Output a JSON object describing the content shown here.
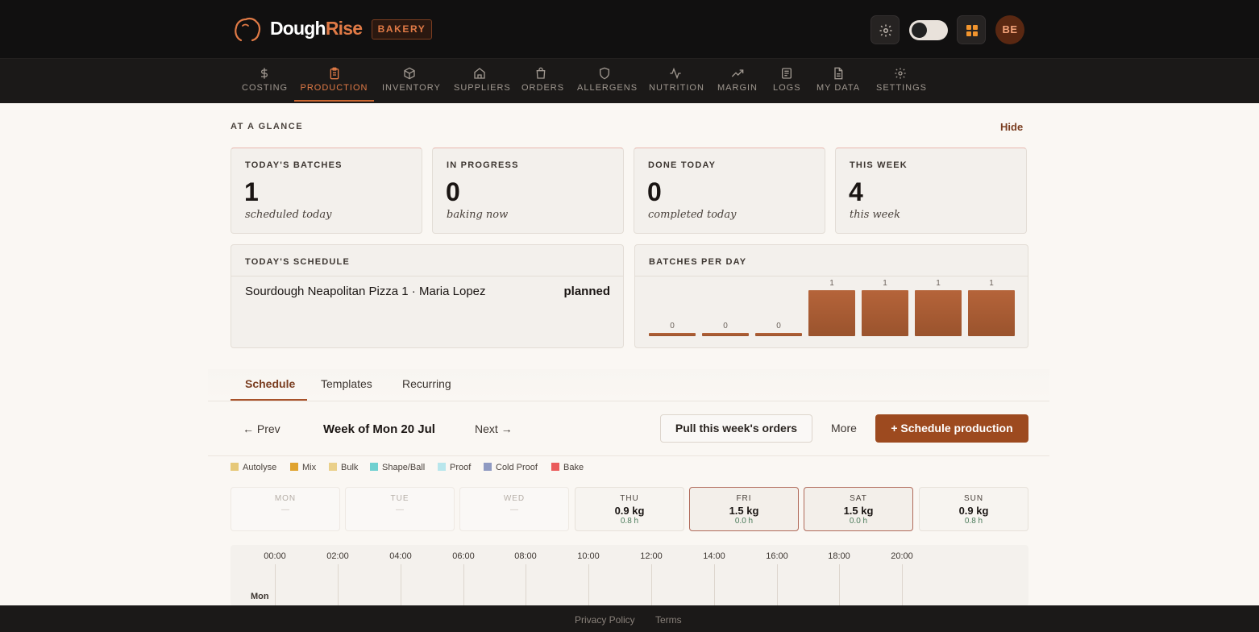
{
  "header": {
    "brand_main": "Dough",
    "brand_accent": "Rise",
    "badge": "BAKERY",
    "avatar_initials": "BE"
  },
  "nav": [
    {
      "label": "COSTING",
      "icon": "dollar-icon"
    },
    {
      "label": "PRODUCTION",
      "icon": "clipboard-icon",
      "active": true
    },
    {
      "label": "INVENTORY",
      "icon": "box-icon"
    },
    {
      "label": "SUPPLIERS",
      "icon": "home-icon"
    },
    {
      "label": "ORDERS",
      "icon": "bag-icon"
    },
    {
      "label": "ALLERGENS",
      "icon": "shield-icon"
    },
    {
      "label": "NUTRITION",
      "icon": "pulse-icon"
    },
    {
      "label": "MARGIN",
      "icon": "trend-up-icon"
    },
    {
      "label": "LOGS",
      "icon": "list-icon"
    },
    {
      "label": "MY DATA",
      "icon": "file-icon"
    },
    {
      "label": "SETTINGS",
      "icon": "gear-icon"
    }
  ],
  "glance": {
    "title": "AT A GLANCE",
    "hide": "Hide",
    "stats": [
      {
        "title": "TODAY'S BATCHES",
        "value": "1",
        "sub": "scheduled today"
      },
      {
        "title": "IN PROGRESS",
        "value": "0",
        "sub": "baking now"
      },
      {
        "title": "DONE TODAY",
        "value": "0",
        "sub": "completed today"
      },
      {
        "title": "THIS WEEK",
        "value": "4",
        "sub": "this week"
      }
    ],
    "schedule": {
      "title": "TODAY'S SCHEDULE",
      "item": "Sourdough Neapolitan Pizza 1 · Maria Lopez",
      "status": "planned"
    },
    "batches_per_day": {
      "title": "BATCHES PER DAY"
    }
  },
  "chart_data": {
    "type": "bar",
    "title": "BATCHES PER DAY",
    "categories": [
      "",
      "",
      "",
      "",
      "",
      "",
      ""
    ],
    "values": [
      0,
      0,
      0,
      1,
      1,
      1,
      1
    ],
    "data_labels": [
      "0",
      "0",
      "0",
      "1",
      "1",
      "1",
      "1"
    ],
    "ylim": [
      0,
      1
    ],
    "grid": false,
    "color": "#a85a33"
  },
  "tabs": [
    {
      "label": "Schedule",
      "active": true
    },
    {
      "label": "Templates"
    },
    {
      "label": "Recurring"
    }
  ],
  "toolbar": {
    "prev": "← Prev",
    "week": "Week of Mon 20 Jul",
    "next": "Next →",
    "pull": "Pull this week's orders",
    "more": "More",
    "schedule": "+ Schedule production"
  },
  "legend": [
    {
      "label": "Autolyse",
      "color": "#e6c878"
    },
    {
      "label": "Mix",
      "color": "#e0a32e"
    },
    {
      "label": "Bulk",
      "color": "#ead08a"
    },
    {
      "label": "Shape/Ball",
      "color": "#6fd0d0"
    },
    {
      "label": "Proof",
      "color": "#b8e6ec"
    },
    {
      "label": "Cold Proof",
      "color": "#8f9ac2"
    },
    {
      "label": "Bake",
      "color": "#ea5b5b"
    }
  ],
  "days": [
    {
      "name": "MON",
      "kg": "—",
      "hours": ""
    },
    {
      "name": "TUE",
      "kg": "—",
      "hours": ""
    },
    {
      "name": "WED",
      "kg": "—",
      "hours": ""
    },
    {
      "name": "THU",
      "kg": "0.9 kg",
      "hours": "0.8 h"
    },
    {
      "name": "FRI",
      "kg": "1.5 kg",
      "hours": "0.0 h"
    },
    {
      "name": "SAT",
      "kg": "1.5 kg",
      "hours": "0.0 h"
    },
    {
      "name": "SUN",
      "kg": "0.9 kg",
      "hours": "0.8 h"
    }
  ],
  "timeline": {
    "hours": [
      "00:00",
      "02:00",
      "04:00",
      "06:00",
      "08:00",
      "10:00",
      "12:00",
      "14:00",
      "16:00",
      "18:00",
      "20:00"
    ],
    "row_label": "Mon"
  },
  "footer": {
    "privacy": "Privacy Policy",
    "terms": "Terms"
  }
}
